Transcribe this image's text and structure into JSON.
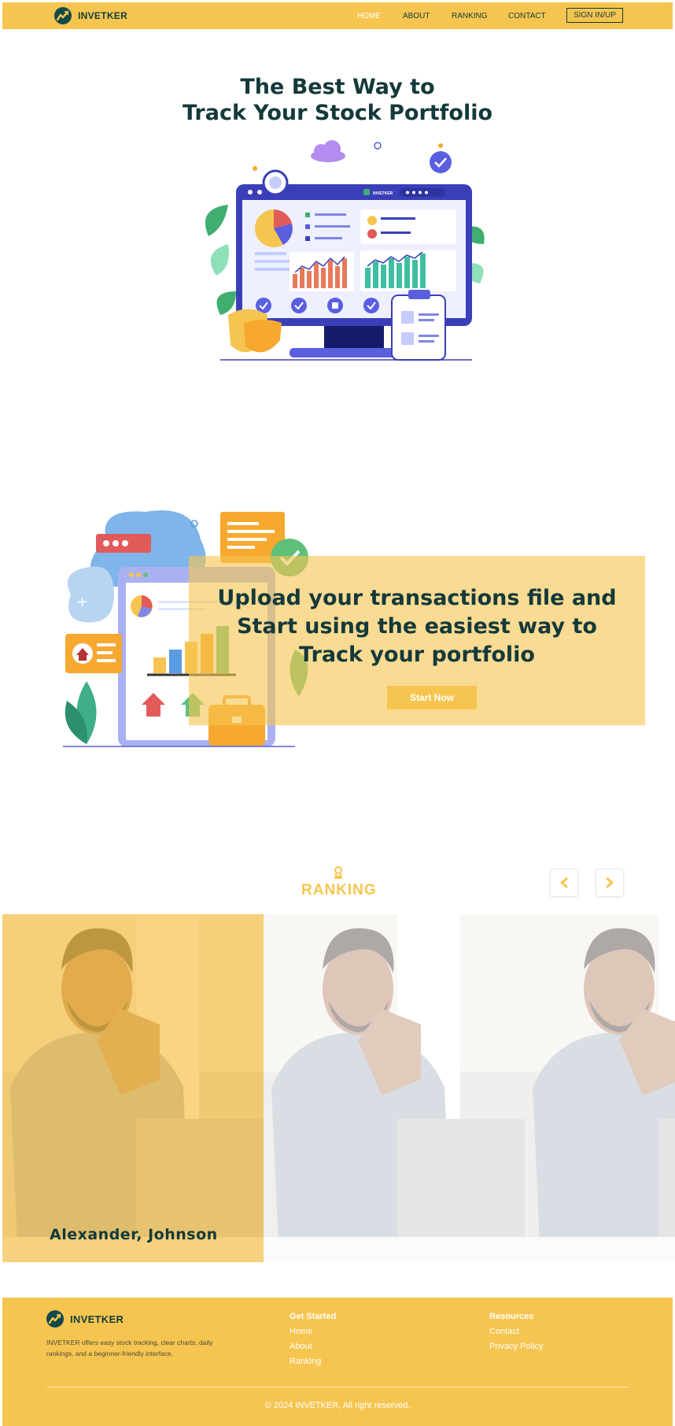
{
  "nav": {
    "brand": "INVETKER",
    "links": [
      {
        "label": "HOME",
        "active": true
      },
      {
        "label": "ABOUT"
      },
      {
        "label": "RANKING"
      },
      {
        "label": "CONTACT"
      }
    ],
    "sign_in": "SIGN IN/UP"
  },
  "hero": {
    "title_line1": "The Best Way to",
    "title_line2": "Track Your Stock Portfolio",
    "monitor_brand": "INVETKER"
  },
  "upload": {
    "line1": "Upload your transactions file and",
    "line2": "Start using the easiest way to",
    "line3": "Track your portfolio",
    "button": "Start Now"
  },
  "ranking": {
    "title": "RANKING",
    "cards": [
      {
        "name": "Alexander, Johnson",
        "highlighted": true
      },
      {
        "name": "",
        "highlighted": false
      },
      {
        "name": "",
        "highlighted": false
      }
    ]
  },
  "footer": {
    "brand": "INVETKER",
    "description": "INVETKER offers easy stock tracking, clear charts, daily rankings, and a beginner-friendly interface.",
    "col1": {
      "heading": "Get Started",
      "links": [
        "Home",
        "About",
        "Ranking"
      ]
    },
    "col2": {
      "heading": "Resources",
      "links": [
        "Contact",
        "Privacy Policy"
      ]
    },
    "copyright": "© 2024 INVETKER, All right reserved."
  },
  "colors": {
    "brand_yellow": "#f6c550",
    "dark_teal": "#14393a",
    "white": "#ffffff"
  },
  "icons": [
    "logo-chart-icon",
    "trophy-icon",
    "chevron-left-icon",
    "chevron-right-icon"
  ]
}
